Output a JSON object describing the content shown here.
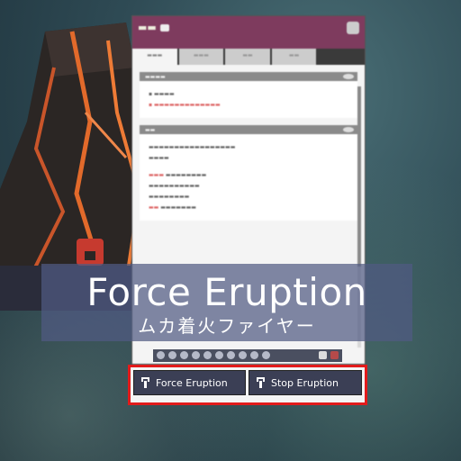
{
  "caption": {
    "title": "Force Eruption",
    "subtitle": "ムカ着火ファイヤー"
  },
  "buttons": {
    "force_label": "Force Eruption",
    "stop_label": "Stop Eruption"
  },
  "colors": {
    "highlight": "#e21b1b",
    "panel_header": "#7e3b5e",
    "button_bg": "#3b3f55"
  }
}
